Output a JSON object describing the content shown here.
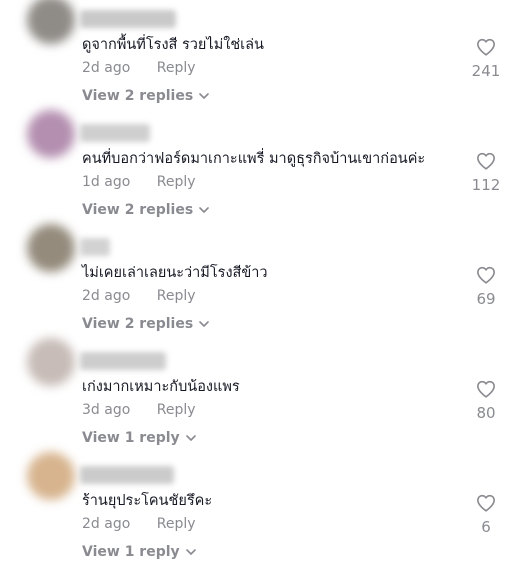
{
  "comments": [
    {
      "text": "ดูจากพื้นที่โรงสี รวยไม่ใช่เล่น",
      "time": "2d ago",
      "reply": "Reply",
      "likes": "241",
      "view_replies": "View 2 replies",
      "avatar_color": "#8f8b86",
      "name_color": "#c9c9c9"
    },
    {
      "text": "คนที่บอกว่าฟอร์ดมาเกาะแพรี่ มาดูธุรกิจบ้านเขาก่อนค่ะ",
      "time": "1d ago",
      "reply": "Reply",
      "likes": "112",
      "view_replies": "View 2 replies",
      "avatar_color": "#b48fb0",
      "name_color": "#cfcfcf"
    },
    {
      "text": "ไม่เคยเล่าเลยนะว่ามีโรงสีข้าว",
      "time": "2d ago",
      "reply": "Reply",
      "likes": "69",
      "view_replies": "View 2 replies",
      "avatar_color": "#948b7c",
      "name_color": "#d2d2d2"
    },
    {
      "text": "เก่งมากเหมาะกับน้องแพร",
      "time": "3d ago",
      "reply": "Reply",
      "likes": "80",
      "view_replies": "View 1 reply",
      "avatar_color": "#c7bcb7",
      "name_color": "#cdcdcd"
    },
    {
      "text": "ร้านยุประโคนชัยรึคะ",
      "time": "2d ago",
      "reply": "Reply",
      "likes": "6",
      "view_replies": "View 1 reply",
      "avatar_color": "#d7b48e",
      "name_color": "#cbcbcb"
    }
  ]
}
